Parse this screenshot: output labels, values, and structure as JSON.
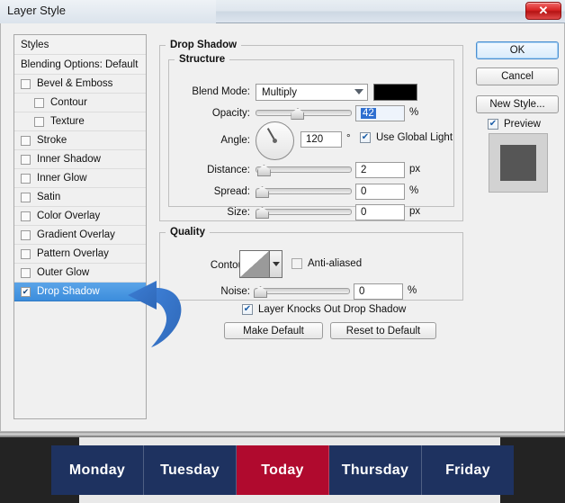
{
  "window": {
    "title": "Layer Style",
    "close_label": "✕",
    "close_icon": "close-icon"
  },
  "background": {
    "watermark_text": "Tuesday"
  },
  "styles_panel": {
    "header": "Styles",
    "blending_options": "Blending Options: Default",
    "items": [
      {
        "label": "Bevel & Emboss",
        "checked": false,
        "sub": false,
        "selected": false
      },
      {
        "label": "Contour",
        "checked": false,
        "sub": true,
        "selected": false
      },
      {
        "label": "Texture",
        "checked": false,
        "sub": true,
        "selected": false
      },
      {
        "label": "Stroke",
        "checked": false,
        "sub": false,
        "selected": false
      },
      {
        "label": "Inner Shadow",
        "checked": false,
        "sub": false,
        "selected": false
      },
      {
        "label": "Inner Glow",
        "checked": false,
        "sub": false,
        "selected": false
      },
      {
        "label": "Satin",
        "checked": false,
        "sub": false,
        "selected": false
      },
      {
        "label": "Color Overlay",
        "checked": false,
        "sub": false,
        "selected": false
      },
      {
        "label": "Gradient Overlay",
        "checked": false,
        "sub": false,
        "selected": false
      },
      {
        "label": "Pattern Overlay",
        "checked": false,
        "sub": false,
        "selected": false
      },
      {
        "label": "Outer Glow",
        "checked": false,
        "sub": false,
        "selected": false
      },
      {
        "label": "Drop Shadow",
        "checked": true,
        "sub": false,
        "selected": true
      }
    ]
  },
  "drop_shadow": {
    "group_title": "Drop Shadow",
    "structure": {
      "title": "Structure",
      "blend_mode": {
        "label": "Blend Mode:",
        "value": "Multiply",
        "color_swatch": "#000000"
      },
      "opacity": {
        "label": "Opacity:",
        "value": "42",
        "unit": "%",
        "slider_percent": 42,
        "selected": true
      },
      "angle": {
        "label": "Angle:",
        "value": "120",
        "unit": "°",
        "dial_degrees": 120
      },
      "use_global_light": {
        "label": "Use Global Light",
        "checked": true
      },
      "distance": {
        "label": "Distance:",
        "value": "2",
        "unit": "px",
        "slider_percent": 2
      },
      "spread": {
        "label": "Spread:",
        "value": "0",
        "unit": "%",
        "slider_percent": 0
      },
      "size": {
        "label": "Size:",
        "value": "0",
        "unit": "px",
        "slider_percent": 0
      }
    },
    "quality": {
      "title": "Quality",
      "contour": {
        "label": "Contour:",
        "preset": "Linear"
      },
      "anti_aliased": {
        "label": "Anti-aliased",
        "checked": false
      },
      "noise": {
        "label": "Noise:",
        "value": "0",
        "unit": "%",
        "slider_percent": 0
      }
    },
    "knockout": {
      "label": "Layer Knocks Out Drop Shadow",
      "checked": true
    },
    "make_default": "Make Default",
    "reset_to_default": "Reset to Default"
  },
  "right_column": {
    "ok": "OK",
    "cancel": "Cancel",
    "new_style": "New Style...",
    "preview": {
      "label": "Preview",
      "checked": true
    }
  },
  "bottom_nav": {
    "tabs": [
      {
        "label": "Monday",
        "active": false
      },
      {
        "label": "Tuesday",
        "active": false
      },
      {
        "label": "Today",
        "active": true
      },
      {
        "label": "Thursday",
        "active": false
      },
      {
        "label": "Friday",
        "active": false
      }
    ],
    "colors": {
      "navy": "#1e3260",
      "crimson": "#b00a2e"
    }
  },
  "annotation": {
    "arrow": "curved-left-arrow"
  }
}
